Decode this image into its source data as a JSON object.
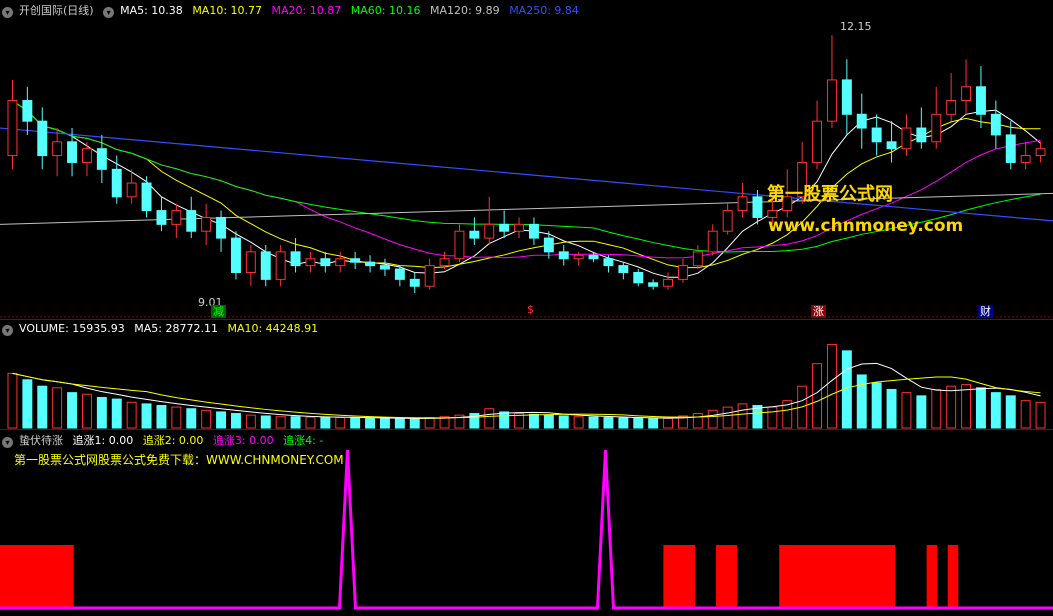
{
  "price_header": {
    "title": "开创国际(日线)",
    "ma5": "MA5: 10.38",
    "ma10": "MA10: 10.77",
    "ma20": "MA20: 10.87",
    "ma60": "MA60: 10.16",
    "ma120": "MA120: 9.89",
    "ma250": "MA250: 9.84",
    "colors": {
      "ma5": "#ffffff",
      "ma10": "#ffff00",
      "ma20": "#ff00ff",
      "ma60": "#00ff00",
      "ma120": "#c0c0c0",
      "ma250": "#3050ff"
    }
  },
  "price_annotations": {
    "high": "12.15",
    "low": "9.01"
  },
  "event_markers": [
    {
      "label": "减",
      "color": "#00ff00",
      "bg": "#006400"
    },
    {
      "label": "$",
      "color": "#ff3030",
      "bg": "transparent"
    },
    {
      "label": "涨",
      "color": "#ffffff",
      "bg": "#8b0000"
    },
    {
      "label": "财",
      "color": "#ffffff",
      "bg": "#00008b"
    }
  ],
  "watermark": {
    "title": "第一股票公式网",
    "url": "www.chnmoney.com"
  },
  "volume_header": {
    "title": "VOLUME: 15935.93",
    "ma5": "MA5: 28772.11",
    "ma10": "MA10: 44248.91"
  },
  "indicator_header": {
    "title": "蛰伏待涨",
    "zz1": "追涨1: 0.00",
    "zz2": "追涨2: 0.00",
    "zz3": "追涨3: 0.00",
    "zz4": "追涨4: -"
  },
  "indicator_note": "第一股票公式网股票公式免费下载：WWW.CHNMONEY.COM",
  "chart_data": {
    "type": "candlestick",
    "candles": [
      [
        10.4,
        11.2,
        11.5,
        10.2
      ],
      [
        11.2,
        10.9,
        11.4,
        10.7
      ],
      [
        10.9,
        10.4,
        11.1,
        10.2
      ],
      [
        10.4,
        10.6,
        10.8,
        10.1
      ],
      [
        10.6,
        10.3,
        10.8,
        10.1
      ],
      [
        10.3,
        10.5,
        10.6,
        10.1
      ],
      [
        10.5,
        10.2,
        10.7,
        10.0
      ],
      [
        10.2,
        9.8,
        10.4,
        9.7
      ],
      [
        9.8,
        10.0,
        10.2,
        9.7
      ],
      [
        10.0,
        9.6,
        10.1,
        9.5
      ],
      [
        9.6,
        9.4,
        9.8,
        9.3
      ],
      [
        9.4,
        9.6,
        9.7,
        9.2
      ],
      [
        9.6,
        9.3,
        9.8,
        9.2
      ],
      [
        9.3,
        9.5,
        9.7,
        9.1
      ],
      [
        9.5,
        9.2,
        9.6,
        9.0
      ],
      [
        9.2,
        8.7,
        9.3,
        8.6
      ],
      [
        8.7,
        9.0,
        9.1,
        8.5
      ],
      [
        9.0,
        8.6,
        9.1,
        8.5
      ],
      [
        8.6,
        9.0,
        9.1,
        8.5
      ],
      [
        9.0,
        8.8,
        9.2,
        8.7
      ],
      [
        8.8,
        8.9,
        9.0,
        8.7
      ],
      [
        8.9,
        8.8,
        9.0,
        8.7
      ],
      [
        8.8,
        8.9,
        9.0,
        8.7
      ],
      [
        8.9,
        8.85,
        9.0,
        8.75
      ],
      [
        8.85,
        8.8,
        8.95,
        8.7
      ],
      [
        8.8,
        8.75,
        8.9,
        8.65
      ],
      [
        8.75,
        8.6,
        8.8,
        8.5
      ],
      [
        8.6,
        8.5,
        8.7,
        8.4
      ],
      [
        8.5,
        8.8,
        8.9,
        8.45
      ],
      [
        8.8,
        8.9,
        9.0,
        8.75
      ],
      [
        8.9,
        9.3,
        9.4,
        8.85
      ],
      [
        9.3,
        9.2,
        9.5,
        9.1
      ],
      [
        9.2,
        9.4,
        9.8,
        9.1
      ],
      [
        9.4,
        9.3,
        9.6,
        9.2
      ],
      [
        9.3,
        9.4,
        9.5,
        9.2
      ],
      [
        9.4,
        9.2,
        9.5,
        9.1
      ],
      [
        9.2,
        9.0,
        9.3,
        8.9
      ],
      [
        9.0,
        8.9,
        9.1,
        8.8
      ],
      [
        8.9,
        8.95,
        9.0,
        8.8
      ],
      [
        8.95,
        8.9,
        9.0,
        8.85
      ],
      [
        8.9,
        8.8,
        8.95,
        8.7
      ],
      [
        8.8,
        8.7,
        8.85,
        8.6
      ],
      [
        8.7,
        8.55,
        8.75,
        8.5
      ],
      [
        8.55,
        8.5,
        8.6,
        8.45
      ],
      [
        8.5,
        8.6,
        8.7,
        8.45
      ],
      [
        8.6,
        8.8,
        8.9,
        8.55
      ],
      [
        8.8,
        9.0,
        9.1,
        8.75
      ],
      [
        9.0,
        9.3,
        9.4,
        8.95
      ],
      [
        9.3,
        9.6,
        9.7,
        9.25
      ],
      [
        9.6,
        9.8,
        10.0,
        9.5
      ],
      [
        9.8,
        9.5,
        9.9,
        9.4
      ],
      [
        9.5,
        9.6,
        9.8,
        9.4
      ],
      [
        9.6,
        9.8,
        10.2,
        9.5
      ],
      [
        9.8,
        10.3,
        10.6,
        9.7
      ],
      [
        10.3,
        10.9,
        11.2,
        10.2
      ],
      [
        10.9,
        11.5,
        12.15,
        10.8
      ],
      [
        11.5,
        11.0,
        11.8,
        10.7
      ],
      [
        11.0,
        10.8,
        11.3,
        10.5
      ],
      [
        10.8,
        10.6,
        11.0,
        10.4
      ],
      [
        10.6,
        10.5,
        10.9,
        10.3
      ],
      [
        10.5,
        10.8,
        11.0,
        10.4
      ],
      [
        10.8,
        10.6,
        11.1,
        10.5
      ],
      [
        10.6,
        11.0,
        11.4,
        10.5
      ],
      [
        11.0,
        11.2,
        11.6,
        10.9
      ],
      [
        11.2,
        11.4,
        11.8,
        11.0
      ],
      [
        11.4,
        11.0,
        11.7,
        10.8
      ],
      [
        11.0,
        10.7,
        11.2,
        10.5
      ],
      [
        10.7,
        10.3,
        10.9,
        10.2
      ],
      [
        10.3,
        10.4,
        10.6,
        10.2
      ],
      [
        10.4,
        10.5,
        10.6,
        10.3
      ]
    ],
    "ylim": [
      8.3,
      12.4
    ],
    "volume": [
      34000,
      30000,
      26000,
      25000,
      22000,
      21000,
      19000,
      18000,
      16000,
      15000,
      14000,
      13000,
      12000,
      11000,
      10000,
      9000,
      8000,
      7500,
      7000,
      7000,
      6800,
      6500,
      6500,
      6300,
      6000,
      6000,
      5800,
      5600,
      6500,
      7000,
      8000,
      9000,
      12000,
      10000,
      9000,
      8500,
      8000,
      7500,
      7000,
      6800,
      6500,
      6300,
      6000,
      5800,
      6000,
      7500,
      9000,
      11000,
      13000,
      15000,
      14000,
      13000,
      17000,
      26000,
      40000,
      52000,
      48000,
      33000,
      28000,
      24000,
      22000,
      20000,
      24000,
      26000,
      27000,
      25000,
      22000,
      20000,
      17000,
      15936
    ],
    "volume_ylim": [
      0,
      56000
    ],
    "zhuizhang3_spikes": [
      0.33,
      0.575
    ],
    "red_blocks": [
      [
        0.0,
        0.07
      ],
      [
        0.63,
        0.66
      ],
      [
        0.68,
        0.7
      ],
      [
        0.74,
        0.85
      ],
      [
        0.88,
        0.89
      ],
      [
        0.9,
        0.91
      ]
    ]
  }
}
